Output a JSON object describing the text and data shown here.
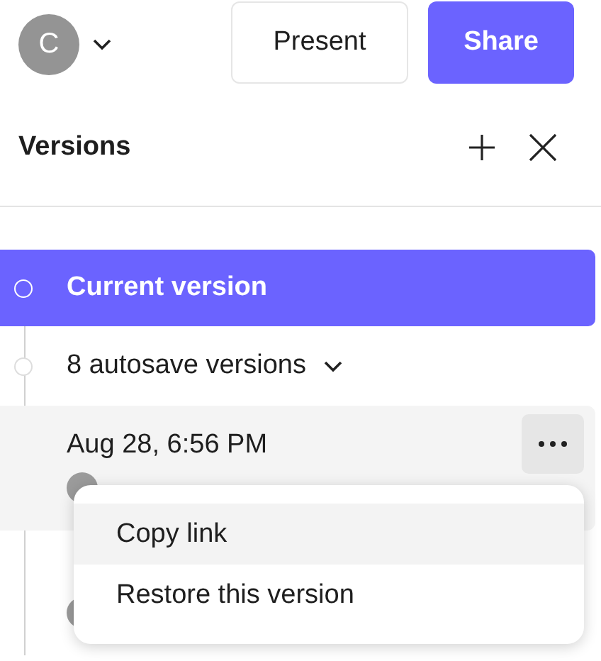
{
  "header": {
    "avatar_initial": "C",
    "buttons": [
      {
        "label": "Present",
        "kind": "secondary"
      },
      {
        "label": "Share",
        "kind": "primary"
      }
    ]
  },
  "panel": {
    "title": "Versions"
  },
  "timeline": [
    {
      "kind": "current",
      "label": "Current version",
      "selected": true
    },
    {
      "kind": "group",
      "label": "8 autosave versions",
      "expanded": true
    },
    {
      "kind": "version",
      "label": "Aug 28, 6:56 PM",
      "hovered": true,
      "menu": [
        {
          "label": "Copy link",
          "selected": true
        },
        {
          "label": "Restore this version",
          "selected": false
        }
      ]
    },
    {
      "kind": "version",
      "hovered": false
    }
  ]
}
